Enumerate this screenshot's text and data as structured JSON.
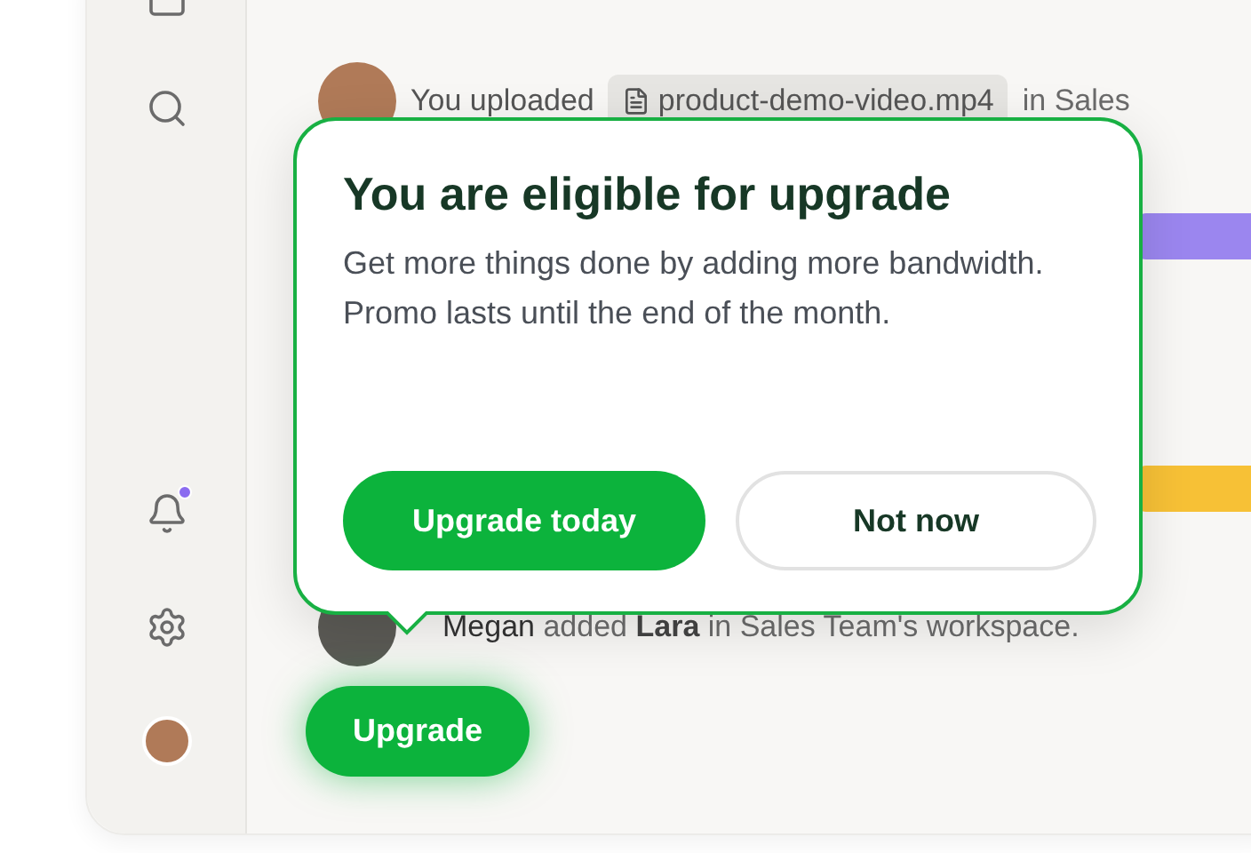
{
  "sidebar": {
    "items": [
      {
        "kind": "square",
        "has_notification": false
      },
      {
        "kind": "search",
        "has_notification": false
      },
      {
        "kind": "bell",
        "has_notification": true
      },
      {
        "kind": "settings",
        "has_notification": false
      },
      {
        "kind": "avatar",
        "has_notification": false
      }
    ]
  },
  "activity": [
    {
      "actor": "You",
      "verb": "uploaded",
      "file": "product-demo-video.mp4",
      "tail": "in Sales"
    },
    {
      "actor": "Megan",
      "verb": "added",
      "object": "Lara",
      "tail": "in Sales Team's workspace."
    }
  ],
  "popover": {
    "title": "You are eligible for upgrade",
    "body": "Get more things done by adding more bandwidth. Promo lasts until the end of the month.",
    "primary": "Upgrade today",
    "secondary": "Not now"
  },
  "upgrade_button": "Upgrade"
}
